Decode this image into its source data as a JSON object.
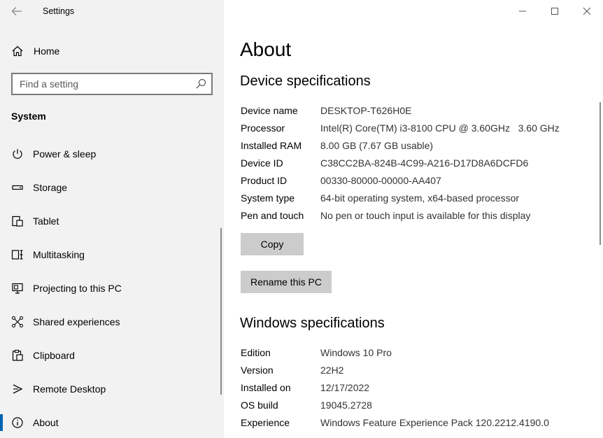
{
  "window": {
    "title": "Settings"
  },
  "sidebar": {
    "home_label": "Home",
    "search_placeholder": "Find a setting",
    "section_title": "System",
    "items": [
      {
        "label": "Power & sleep",
        "icon": "power-icon"
      },
      {
        "label": "Storage",
        "icon": "storage-icon"
      },
      {
        "label": "Tablet",
        "icon": "tablet-icon"
      },
      {
        "label": "Multitasking",
        "icon": "multitasking-icon"
      },
      {
        "label": "Projecting to this PC",
        "icon": "projecting-icon"
      },
      {
        "label": "Shared experiences",
        "icon": "shared-experiences-icon"
      },
      {
        "label": "Clipboard",
        "icon": "clipboard-icon"
      },
      {
        "label": "Remote Desktop",
        "icon": "remote-desktop-icon"
      },
      {
        "label": "About",
        "icon": "info-icon",
        "selected": true
      }
    ]
  },
  "main": {
    "page_title": "About",
    "device_specs": {
      "heading": "Device specifications",
      "rows": [
        {
          "label": "Device name",
          "value": "DESKTOP-T626H0E"
        },
        {
          "label": "Processor",
          "value": "Intel(R) Core(TM) i3-8100 CPU @ 3.60GHz   3.60 GHz"
        },
        {
          "label": "Installed RAM",
          "value": "8.00 GB (7.67 GB usable)"
        },
        {
          "label": "Device ID",
          "value": "C38CC2BA-824B-4C99-A216-D17D8A6DCFD6"
        },
        {
          "label": "Product ID",
          "value": "00330-80000-00000-AA407"
        },
        {
          "label": "System type",
          "value": "64-bit operating system, x64-based processor"
        },
        {
          "label": "Pen and touch",
          "value": "No pen or touch input is available for this display"
        }
      ],
      "copy_label": "Copy",
      "rename_label": "Rename this PC"
    },
    "windows_specs": {
      "heading": "Windows specifications",
      "rows": [
        {
          "label": "Edition",
          "value": "Windows 10 Pro"
        },
        {
          "label": "Version",
          "value": "22H2"
        },
        {
          "label": "Installed on",
          "value": "12/17/2022"
        },
        {
          "label": "OS build",
          "value": "19045.2728"
        },
        {
          "label": "Experience",
          "value": "Windows Feature Experience Pack 120.2212.4190.0"
        }
      ]
    }
  },
  "colors": {
    "sidebar_bg": "#f2f2f2",
    "accent": "#0063b1",
    "button_bg": "#cccccc"
  }
}
